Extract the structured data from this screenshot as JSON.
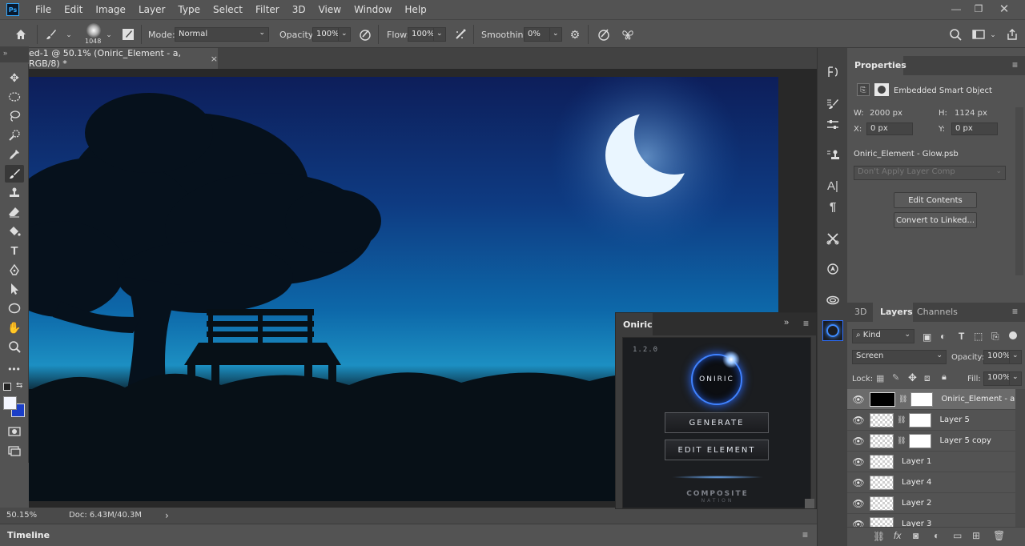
{
  "menubar": {
    "logo": "Ps",
    "items": [
      "File",
      "Edit",
      "Image",
      "Layer",
      "Type",
      "Select",
      "Filter",
      "3D",
      "View",
      "Window",
      "Help"
    ]
  },
  "options": {
    "brush_size": "1048",
    "mode_label": "Mode:",
    "mode_value": "Normal",
    "opacity_label": "Opacity:",
    "opacity_value": "100%",
    "flow_label": "Flow:",
    "flow_value": "100%",
    "smoothing_label": "Smoothing:",
    "smoothing_value": "0%"
  },
  "document": {
    "tab_title": "ed-1 @ 50.1% (Oniric_Element - a, RGB/8) *",
    "close_glyph": "×"
  },
  "status": {
    "zoom": "50.15%",
    "doc": "Doc: 6.43M/40.3M",
    "arrow": "›"
  },
  "timeline": {
    "label": "Timeline"
  },
  "properties": {
    "tab": "Properties",
    "type": "Embedded Smart Object",
    "w_label": "W:",
    "w_value": "2000 px",
    "h_label": "H:",
    "h_value": "1124 px",
    "x_label": "X:",
    "x_value": "0 px",
    "y_label": "Y:",
    "y_value": "0 px",
    "file": "Oniric_Element - Glow.psb",
    "layer_comp": "Don't Apply Layer Comp",
    "edit_contents": "Edit Contents",
    "convert_linked": "Convert to Linked..."
  },
  "layers": {
    "tabs": [
      "3D",
      "Layers",
      "Channels"
    ],
    "kind": "Kind",
    "blend_mode": "Screen",
    "opacity_label": "Opacity:",
    "opacity_value": "100%",
    "lock_label": "Lock:",
    "fill_label": "Fill:",
    "fill_value": "100%",
    "rows": [
      {
        "name": "Oniric_Element - a"
      },
      {
        "name": "Layer 5"
      },
      {
        "name": "Layer 5 copy"
      },
      {
        "name": "Layer 1"
      },
      {
        "name": "Layer 4"
      },
      {
        "name": "Layer 2"
      },
      {
        "name": "Layer 3"
      }
    ],
    "footer_fx": "fx"
  },
  "oniric": {
    "title": "Oniric",
    "version": "1.2.0",
    "logo_text": "ONIRIC",
    "generate": "GENERATE",
    "edit_element": "EDIT ELEMENT",
    "brand_line1": "COMPOSITE",
    "brand_line2": "NATION"
  },
  "icons": {
    "home": "home-icon",
    "brush": "brush-icon"
  }
}
